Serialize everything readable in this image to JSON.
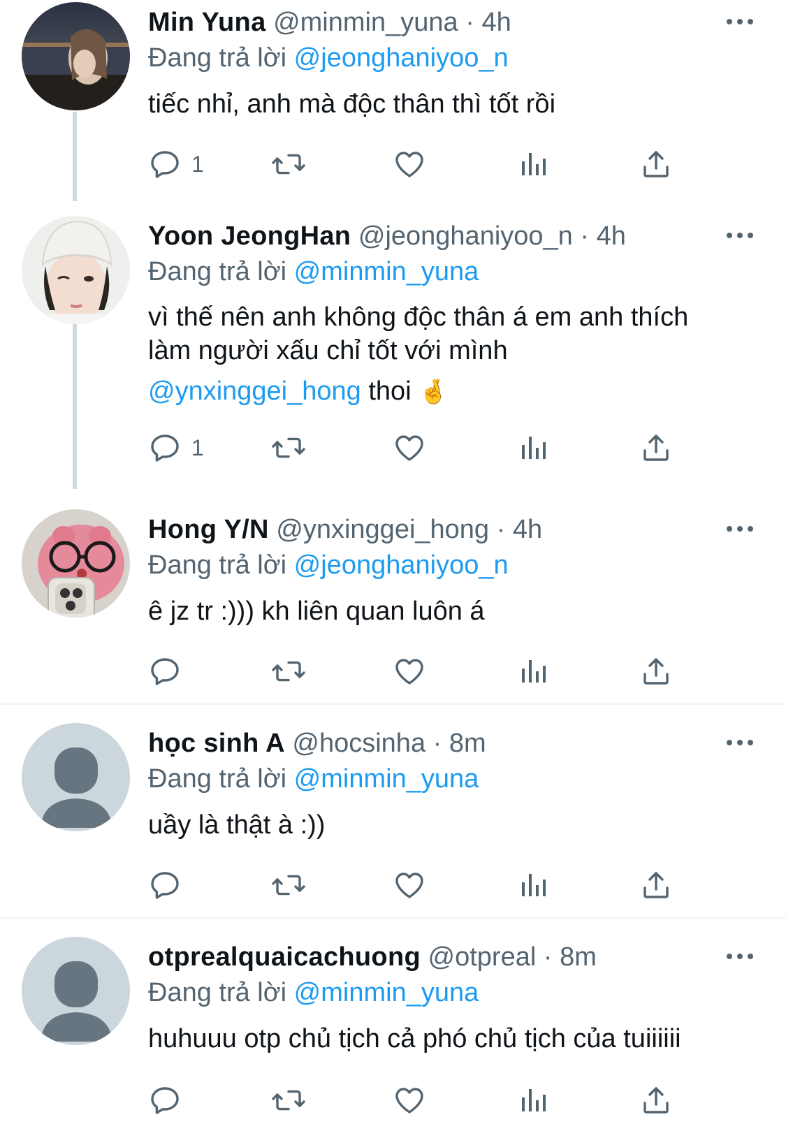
{
  "tweets": [
    {
      "name": "Min Yuna",
      "handle": "@minmin_yuna",
      "separator": "·",
      "time": "4h",
      "reply_prefix": "Đang trả lời",
      "reply_to": "@jeonghaniyoo_n",
      "text_lines": [
        "tiếc nhỉ, anh mà độc thân thì tốt rồi"
      ],
      "reply_count": "1",
      "avatar": "photo-night-river"
    },
    {
      "name": "Yoon JeongHan",
      "handle": "@jeonghaniyoo_n",
      "separator": "·",
      "time": "4h",
      "reply_prefix": "Đang trả lời",
      "reply_to": "@minmin_yuna",
      "text_lines": [
        "vì thế nên anh không độc thân á em anh thích",
        "làm người xấu chỉ tốt với mình"
      ],
      "text_mention": "@ynxinggei_hong",
      "text_tail": " thoi ",
      "emoji": "crossed-fingers-emoji",
      "reply_count": "1",
      "avatar": "photo-white-beanie"
    },
    {
      "name": "Hong Y/N",
      "handle": "@ynxinggei_hong",
      "separator": "·",
      "time": "4h",
      "reply_prefix": "Đang trả lời",
      "reply_to": "@jeonghaniyoo_n",
      "text_lines": [
        "ê jz tr :))) kh liên quan luôn á"
      ],
      "reply_count": "",
      "avatar": "photo-pink-plush-glasses"
    },
    {
      "name": "học sinh A",
      "handle": "@hocsinha",
      "separator": "·",
      "time": "8m",
      "reply_prefix": "Đang trả lời",
      "reply_to": "@minmin_yuna",
      "text_lines": [
        "uầy là thật à :))"
      ],
      "reply_count": "",
      "avatar": "default-avatar"
    },
    {
      "name": "otprealquaicachuong",
      "handle": "@otpreal",
      "separator": "·",
      "time": "8m",
      "reply_prefix": "Đang trả lời",
      "reply_to": "@minmin_yuna",
      "text_lines": [
        "huhuuu otp chủ tịch cả phó chủ tịch của tuiiiiii"
      ],
      "reply_count": "",
      "avatar": "default-avatar"
    }
  ],
  "colors": {
    "text": "#0f1419",
    "secondary": "#536471",
    "link": "#1d9bf0",
    "thread_line": "#cfd9de",
    "separator": "#eff3f4",
    "default_avatar_bg": "#ccd6dd",
    "default_avatar_fg": "#66757f"
  }
}
